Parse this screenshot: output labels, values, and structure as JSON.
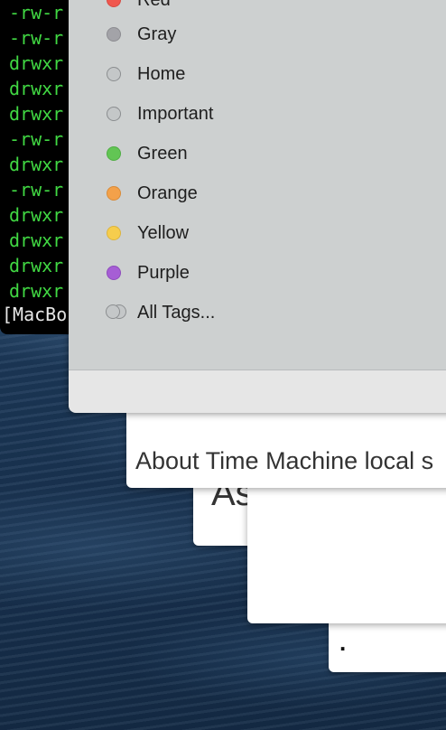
{
  "terminal": {
    "lines": [
      "-rw-r",
      "-rw-r",
      "drwxr",
      "drwxr",
      "drwxr",
      "-rw-r",
      "drwxr",
      "-rw-r",
      "drwxr",
      "drwxr",
      "drwxr",
      "drwxr"
    ],
    "prompt": "[MacBo"
  },
  "tags_menu": {
    "items": [
      {
        "label": "Red",
        "color": "#f0574e"
      },
      {
        "label": "Gray",
        "color": "#a3a3a8"
      },
      {
        "label": "Home",
        "color": "none"
      },
      {
        "label": "Important",
        "color": "none"
      },
      {
        "label": "Green",
        "color": "#62c554"
      },
      {
        "label": "Orange",
        "color": "#f3a14a"
      },
      {
        "label": "Yellow",
        "color": "#f6cd4d"
      },
      {
        "label": "Purple",
        "color": "#a65ed5"
      }
    ],
    "all_tags_label": "All Tags..."
  },
  "background_windows": {
    "article_heading": "About Time Machine local s",
    "partial_heading": "As",
    "partial_char": "."
  }
}
